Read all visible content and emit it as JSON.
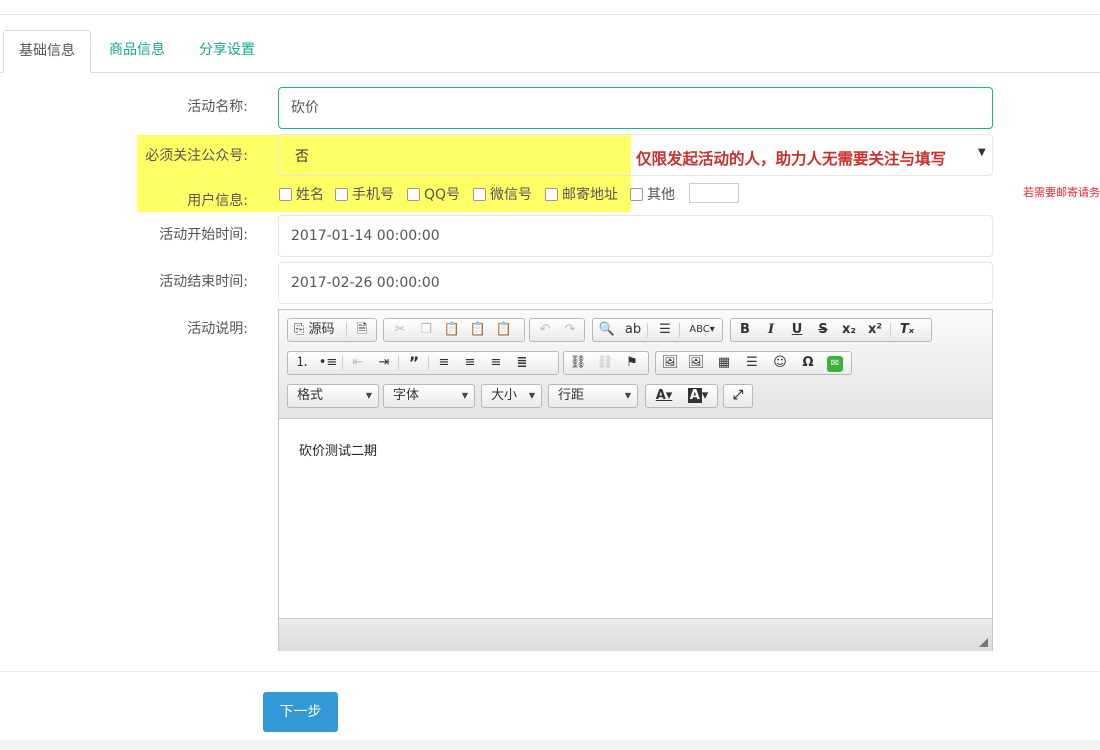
{
  "tabs": [
    {
      "label": "基础信息",
      "active": true
    },
    {
      "label": "商品信息",
      "active": false
    },
    {
      "label": "分享设置",
      "active": false
    }
  ],
  "form": {
    "name_label": "活动名称:",
    "name_value": "砍价",
    "follow_label": "必须关注公众号:",
    "follow_value": "否",
    "follow_hint": "仅限发起活动的人，助力人无需要关注与填写",
    "userinfo_label": "用户信息:",
    "userinfo_options": [
      "姓名",
      "手机号",
      "QQ号",
      "微信号",
      "邮寄地址",
      "其他"
    ],
    "userinfo_hint": "若需要邮寄请务",
    "start_label": "活动开始时间:",
    "start_value": "2017-01-14 00:00:00",
    "end_label": "活动结束时间:",
    "end_value": "2017-02-26 00:00:00",
    "desc_label": "活动说明:"
  },
  "editor": {
    "source_label": "源码",
    "format_label": "格式",
    "font_label": "字体",
    "size_label": "大小",
    "lineheight_label": "行距",
    "content": "砍价测试二期"
  },
  "next_button": "下一步",
  "colors": {
    "accent": "#18a689",
    "highlight": "#ffff66",
    "hint_red": "#c9302c",
    "button_blue": "#3399d6"
  }
}
